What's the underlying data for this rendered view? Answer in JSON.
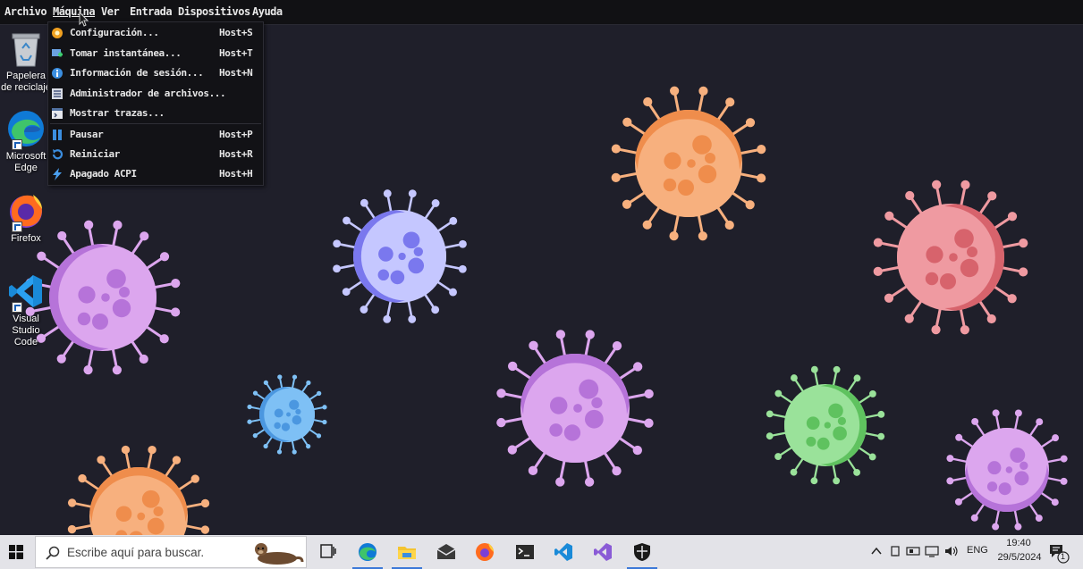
{
  "menubar": {
    "items": [
      "Archivo",
      "Máquina",
      "Ver",
      "Entrada",
      "Dispositivos",
      "Ayuda"
    ],
    "active": "Máquina"
  },
  "machine_menu": {
    "items": [
      {
        "label": "Configuración...",
        "shortcut": "Host+S",
        "icon": "settings-gear-icon"
      },
      {
        "label": "Tomar instantánea...",
        "shortcut": "Host+T",
        "icon": "snapshot-icon"
      },
      {
        "label": "Información de sesión...",
        "shortcut": "Host+N",
        "icon": "info-icon"
      },
      {
        "label": "Administrador de archivos...",
        "shortcut": "",
        "icon": "file-manager-icon"
      },
      {
        "label": "Mostrar trazas...",
        "shortcut": "",
        "icon": "log-viewer-icon"
      },
      {
        "label": "Pausar",
        "shortcut": "Host+P",
        "icon": "pause-icon"
      },
      {
        "label": "Reiniciar",
        "shortcut": "Host+R",
        "icon": "restart-icon"
      },
      {
        "label": "Apagado ACPI",
        "shortcut": "Host+H",
        "icon": "power-bolt-icon"
      }
    ]
  },
  "desktop_icons": [
    {
      "label": "Papelera de reciclaje",
      "icon": "recycle-bin-icon"
    },
    {
      "label": "Microsoft Edge",
      "icon": "edge-icon"
    },
    {
      "label": "Firefox",
      "icon": "firefox-icon"
    },
    {
      "label": "Visual Studio Code",
      "icon": "vscode-icon"
    }
  ],
  "taskbar": {
    "search_placeholder": "Escribe aquí para buscar.",
    "apps": [
      "task-view-icon",
      "edge-icon",
      "file-explorer-icon",
      "mail-icon",
      "firefox-icon",
      "terminal-icon",
      "vscode-icon",
      "visual-studio-icon",
      "security-shield-icon"
    ],
    "language": "ENG",
    "time": "19:40",
    "date": "29/5/2024",
    "notification_count": "1"
  },
  "colors": {
    "desktop_bg": "#1f1f2a",
    "menubar_bg": "#111114",
    "taskbar_bg": "#e3e3e8",
    "accent": "#3b78d8"
  }
}
